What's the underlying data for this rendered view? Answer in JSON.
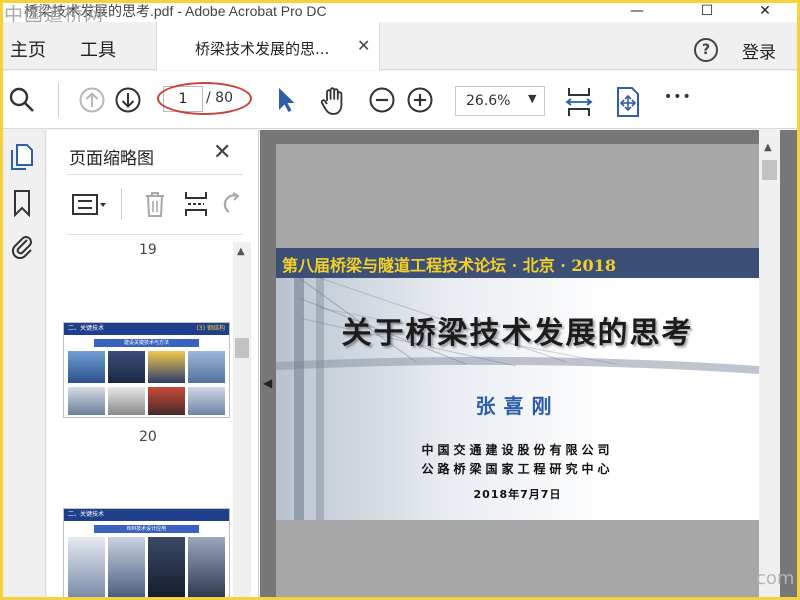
{
  "watermarks": {
    "top_left": "中国道桥网",
    "bottom_right": "com"
  },
  "window": {
    "title": "桥梁技术发展的思考.pdf - Adobe Acrobat Pro DC",
    "minimize": "—",
    "maximize": "☐",
    "close": "✕"
  },
  "menu": {
    "home": "主页",
    "tools": "工具",
    "login": "登录",
    "help": "?"
  },
  "tab": {
    "label": "桥梁技术发展的思...",
    "close": "✕"
  },
  "toolbar": {
    "page_current": "1",
    "page_total": "/ 80",
    "zoom": "26.6%",
    "zoom_caret": "▼",
    "more": "•••"
  },
  "colors": {
    "accent_red": "#c8403a",
    "header_blue": "#3c4f77",
    "header_yellow": "#f2d027",
    "author_blue": "#2e5ea8"
  },
  "thumbnails_panel": {
    "title": "页面缩略图",
    "close": "✕",
    "pages": [
      {
        "number": "19"
      },
      {
        "number": "20",
        "header": "二、关键技术",
        "tag": "(3) 钢结构",
        "bar": "建设关键技术与方法"
      },
      {
        "header": "二、关键技术",
        "bar": "BIM技术设计应用"
      }
    ]
  },
  "slide": {
    "header": "第八届桥梁与隧道工程技术论坛 · 北京 · 2018",
    "title": "关于桥梁技术发展的思考",
    "author": "张喜刚",
    "org1": "中国交通建设股份有限公司",
    "org2": "公路桥梁国家工程研究中心",
    "date": "2018年7月7日"
  }
}
